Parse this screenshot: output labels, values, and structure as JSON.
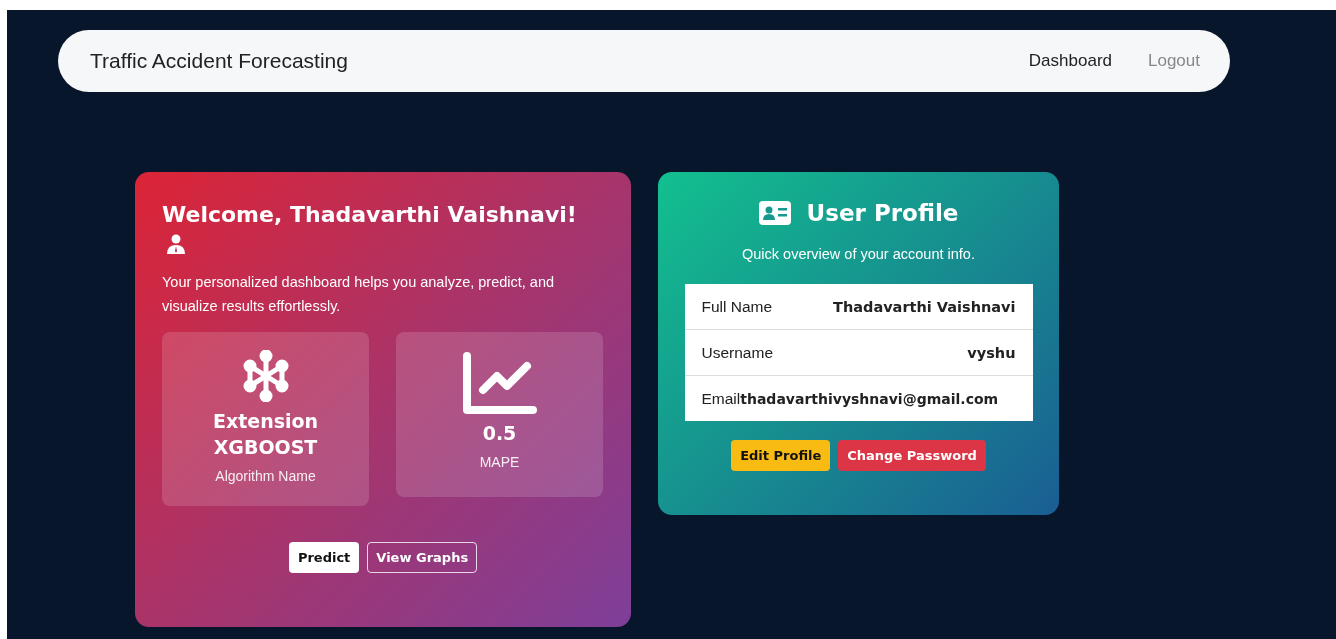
{
  "navbar": {
    "brand": "Traffic Accident Forecasting",
    "links": [
      {
        "label": "Dashboard",
        "selected": true
      },
      {
        "label": "Logout",
        "selected": false
      }
    ]
  },
  "welcome": {
    "title": "Welcome, Thadavarthi Vaishnavi!",
    "text": "Your personalized dashboard helps you analyze, predict, and visualize results effortlessly.",
    "stats": [
      {
        "kind": "algorithm",
        "value": "Extension XGBOOST",
        "label": "Algorithm Name"
      },
      {
        "kind": "metric",
        "value": "0.5",
        "label": "MAPE"
      }
    ],
    "buttons": [
      {
        "label": "Predict",
        "kind": "solid"
      },
      {
        "label": "View Graphs",
        "kind": "outline"
      }
    ]
  },
  "profile": {
    "title": "User Profile",
    "subtitle": "Quick overview of your account info.",
    "rows": [
      {
        "label": "Full Name",
        "value": "Thadavarthi Vaishnavi",
        "kind": "split"
      },
      {
        "label": "Username",
        "value": "vyshu",
        "kind": "split"
      },
      {
        "label": "Email",
        "value": "thadavarthivyshnavi@gmail.com",
        "kind": "joined"
      }
    ],
    "buttons": [
      {
        "label": "Edit Profile",
        "kind": "warning"
      },
      {
        "label": "Change Password",
        "kind": "danger"
      }
    ]
  }
}
